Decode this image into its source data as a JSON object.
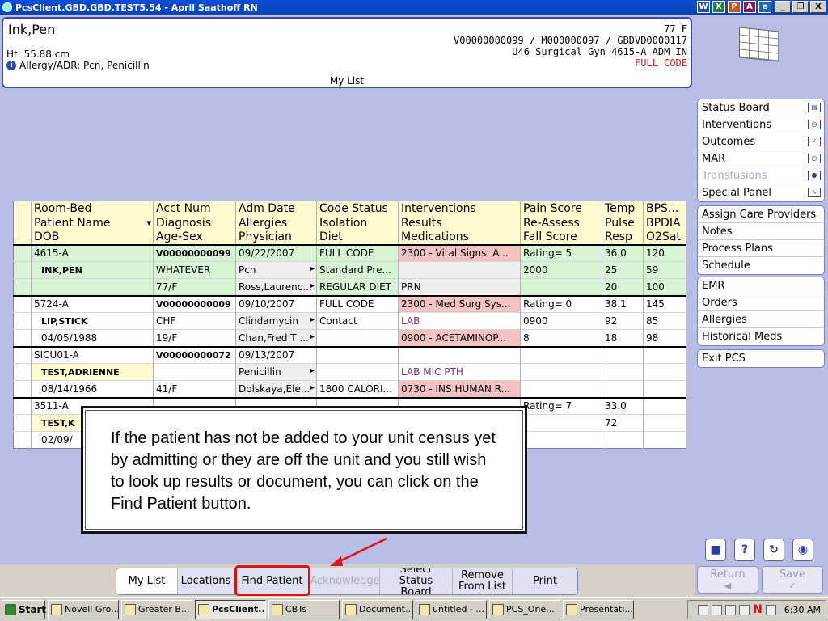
{
  "window": {
    "title": "PcsClient.GBD.GBD.TEST5.54 - April Saathoff RN",
    "title_icons": [
      "W",
      "X",
      "P",
      "A",
      "e"
    ],
    "controls": [
      "_",
      "❐",
      "X"
    ]
  },
  "patient_header": {
    "name": "Ink,Pen",
    "age_sex": "77 F",
    "height": "Ht: 55.88 cm",
    "allergy": "Allergy/ADR: Pcn, Penicillin",
    "ids": "V00000000099 / M000000097 / GBDVD0000117",
    "location": "U46 Surgical Gyn  4615-A  ADM IN",
    "code_status": "FULL CODE",
    "list_title": "My List"
  },
  "side_nav": {
    "group1": [
      {
        "label": "Status Board",
        "icon": "book-icon",
        "glyph": "▤",
        "disabled": false
      },
      {
        "label": "Interventions",
        "icon": "stopwatch-icon",
        "glyph": "◷",
        "disabled": false
      },
      {
        "label": "Outcomes",
        "icon": "checklist-icon",
        "glyph": "✓",
        "disabled": false
      },
      {
        "label": "MAR",
        "icon": "clock-icon",
        "glyph": "◷",
        "disabled": false
      },
      {
        "label": "Transfusions",
        "icon": "blood-bag-icon",
        "glyph": "●",
        "disabled": true
      },
      {
        "label": "Special Panel",
        "icon": "waveform-icon",
        "glyph": "∿",
        "disabled": false
      }
    ],
    "group2": [
      "Assign Care Providers",
      "Notes",
      "Process Plans",
      "Schedule"
    ],
    "group3": [
      "EMR",
      "Orders",
      "Allergies",
      "Historical Meds"
    ],
    "group4": [
      "Exit PCS"
    ],
    "return_label": "Return",
    "save_label": "Save"
  },
  "table": {
    "headers": [
      [
        "Room-Bed",
        "Acct Num",
        "Adm Date",
        "Code Status",
        "Interventions",
        "Pain Score",
        "Temp",
        "BPS..."
      ],
      [
        "Patient Name",
        "Diagnosis",
        "Allergies",
        "Isolation",
        "Results",
        "Re-Assess",
        "Pulse",
        "BPDIA"
      ],
      [
        "DOB",
        "Age-Sex",
        "Physician",
        "Diet",
        "Medications",
        "Fall Score",
        "Resp",
        "O2Sat"
      ]
    ],
    "patients": [
      {
        "rows": [
          [
            "4615-A",
            "V00000000099",
            "09/22/2007",
            "FULL CODE",
            "2300 - Vital Signs: A...",
            "Rating= 5",
            "36.0",
            "120"
          ],
          [
            "INK,PEN",
            "WHATEVER",
            "Pcn",
            "Standard Pre...",
            "",
            "2000",
            "25",
            "59"
          ],
          [
            "",
            "77/F",
            "Ross,Laurenc...",
            "REGULAR DIET",
            "PRN",
            "",
            "20",
            "100"
          ]
        ]
      },
      {
        "rows": [
          [
            "5724-A",
            "V00000000009",
            "09/10/2007",
            "FULL CODE",
            "2300 - Med Surg Sys...",
            "Rating= 0",
            "38.1",
            "145"
          ],
          [
            "LIP,STICK",
            "CHF",
            "Clindamycin",
            "Contact",
            "LAB",
            "0900",
            "92",
            "85"
          ],
          [
            "04/05/1988",
            "19/F",
            "Chan,Fred T ...",
            "",
            "0900 - ACETAMINOP...",
            "8",
            "18",
            "98"
          ]
        ]
      },
      {
        "rows": [
          [
            "SICU01-A",
            "V00000000072",
            "09/13/2007",
            "",
            "",
            "",
            "",
            ""
          ],
          [
            "TEST,ADRIENNE",
            "",
            "Penicillin",
            "",
            "LAB MIC PTH",
            "",
            "",
            ""
          ],
          [
            "08/14/1966",
            "41/F",
            "Dolskaya,Ele...",
            "1800 CALORI...",
            "0730 - INS HUMAN R...",
            "",
            "",
            ""
          ]
        ]
      },
      {
        "rows": [
          [
            "3511-A",
            "",
            "",
            "",
            "",
            "Rating= 7",
            "33.0",
            ""
          ],
          [
            "TEST,K",
            "",
            "",
            "",
            "",
            "",
            "72",
            ""
          ],
          [
            "02/09/",
            "",
            "",
            "",
            "",
            "",
            "",
            ""
          ]
        ]
      }
    ]
  },
  "callout": {
    "text": "If the patient has not be added to your unit census yet by admitting or they are off the unit and you still wish to look up results or document, you can click on the Find Patient button."
  },
  "toolbar": {
    "buttons": [
      "My List",
      "Locations",
      "Find Patient",
      "Acknowledge",
      "Select Status Board",
      "Remove From List",
      "Print"
    ]
  },
  "taskbar": {
    "start": "Start",
    "items": [
      "Novell Gro...",
      "Greater B...",
      "PcsClient...",
      "CBTs",
      "Document...",
      "untitled - ...",
      "PCS_One...",
      "Presentati..."
    ],
    "clock": "6:30 AM"
  },
  "colors": {
    "panel_bg": "#b9bde6",
    "header_row": "#fffbd0",
    "selected_row": "#d7f5d4",
    "overdue": "#f5c2c2",
    "code_status": "#e0201c",
    "highlight": "#e01010"
  }
}
